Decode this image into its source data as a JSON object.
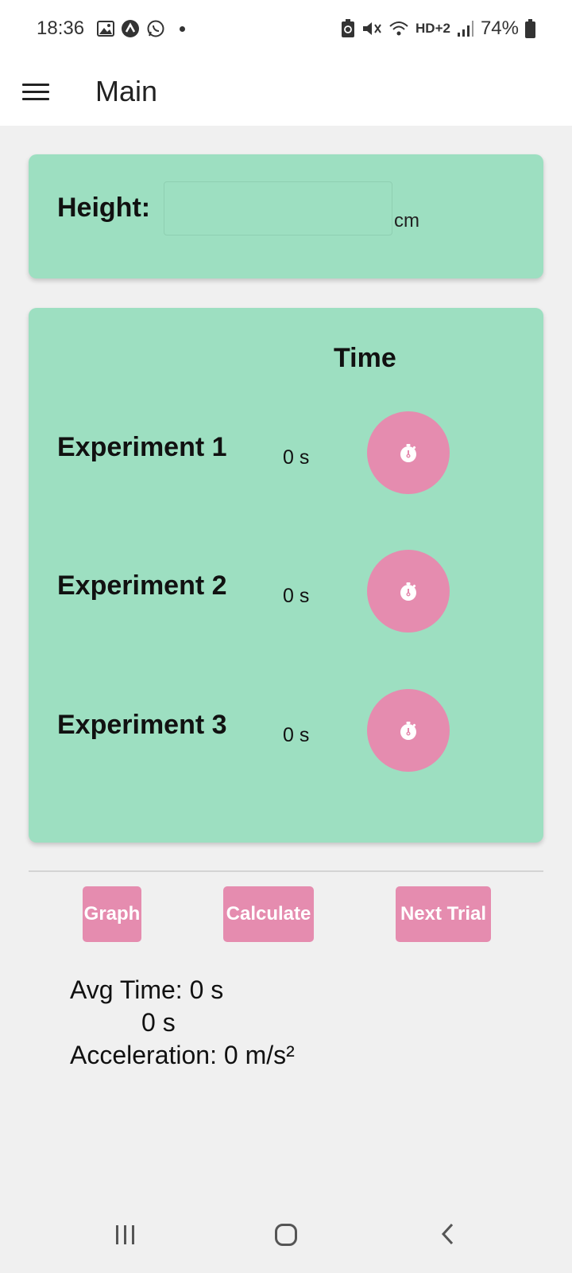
{
  "status_bar": {
    "time": "18:36",
    "network": "HD+2",
    "battery": "74%"
  },
  "app_bar": {
    "title": "Main"
  },
  "height_card": {
    "label": "Height:",
    "value": "",
    "unit": "cm"
  },
  "time_card": {
    "header": "Time",
    "experiments": [
      {
        "label": "Experiment 1",
        "time": "0 s"
      },
      {
        "label": "Experiment 2",
        "time": "0 s"
      },
      {
        "label": "Experiment 3",
        "time": "0 s"
      }
    ]
  },
  "actions": {
    "graph": "Graph",
    "calculate": "Calculate",
    "next_trial": "Next Trial"
  },
  "results": {
    "avg_time": "Avg Time: 0 s",
    "second_time": "0 s",
    "acceleration": "Acceleration: 0 m/s²"
  },
  "colors": {
    "card_bg": "#9ddfc1",
    "accent_pink": "#e58caf",
    "page_bg": "#f0f0f0"
  }
}
